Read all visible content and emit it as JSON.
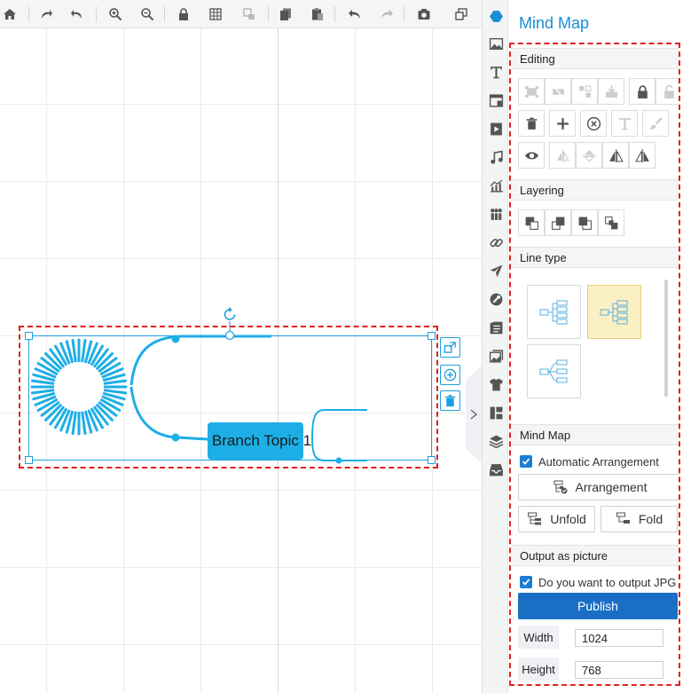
{
  "toolbar": {
    "icons": [
      "home-icon",
      "redo-curve-icon",
      "undo-curve-icon",
      "zoom-in-icon",
      "zoom-out-icon",
      "lock-icon",
      "grid-icon",
      "format-icon",
      "copy-icon",
      "paste-icon",
      "undo-icon",
      "redo-icon",
      "camera-icon",
      "resize-icon"
    ]
  },
  "canvas": {
    "branch_topic": "Branch Topic 1",
    "accent": "#1daee6",
    "selection_color": "#e02020"
  },
  "iconbar": {
    "items": [
      "mindmap-icon",
      "image-icon",
      "text-icon",
      "layout-icon",
      "video-icon",
      "music-icon",
      "chart-icon",
      "people-icon",
      "link-icon",
      "plane-icon",
      "wrench-icon",
      "notes-icon",
      "gallery-icon",
      "shirt-icon",
      "table-icon",
      "layers-icon",
      "inbox-icon"
    ]
  },
  "panel": {
    "title": "Mind Map",
    "editing": {
      "heading": "Editing"
    },
    "layering": {
      "heading": "Layering"
    },
    "line_type": {
      "heading": "Line type"
    },
    "mind_map": {
      "heading": "Mind Map",
      "auto_arrange_label": "Automatic Arrangement",
      "auto_arrange_checked": true,
      "arrangement_button": "Arrangement",
      "unfold_button": "Unfold",
      "fold_button": "Fold"
    },
    "output": {
      "heading": "Output as picture",
      "jpg_label": "Do you want to output JPG p",
      "jpg_checked": true,
      "publish_button": "Publish",
      "width_label": "Width",
      "width_value": "1024",
      "height_label": "Height",
      "height_value": "768"
    }
  }
}
